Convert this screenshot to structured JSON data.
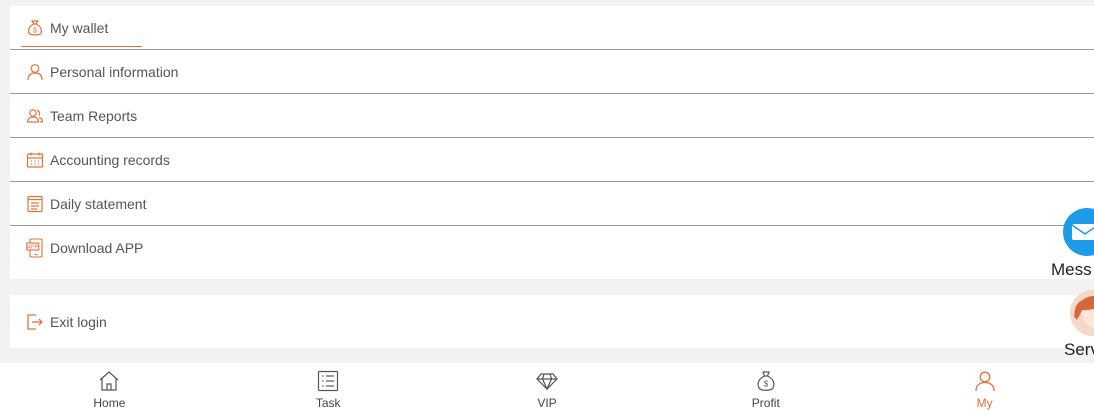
{
  "colors": {
    "accent": "#e0733a",
    "icon": "#e0733a",
    "text": "#555555",
    "message_bubble": "#1e9be8"
  },
  "menu": {
    "items": [
      {
        "label": "My wallet",
        "icon": "money-bag-icon",
        "active": true
      },
      {
        "label": "Personal information",
        "icon": "person-icon",
        "active": false
      },
      {
        "label": "Team Reports",
        "icon": "team-icon",
        "active": false
      },
      {
        "label": "Accounting records",
        "icon": "calendar-icon",
        "active": false
      },
      {
        "label": "Daily statement",
        "icon": "document-icon",
        "active": false
      },
      {
        "label": "Download APP",
        "icon": "app-icon",
        "active": false
      }
    ]
  },
  "exit": {
    "label": "Exit login",
    "icon": "exit-icon"
  },
  "floating": {
    "message_label": "Mess",
    "service_label": "Serv"
  },
  "tabbar": {
    "tabs": [
      {
        "label": "Home",
        "icon": "home-icon",
        "active": false
      },
      {
        "label": "Task",
        "icon": "task-list-icon",
        "active": false
      },
      {
        "label": "VIP",
        "icon": "diamond-icon",
        "active": false
      },
      {
        "label": "Profit",
        "icon": "money-bag-icon",
        "active": false
      },
      {
        "label": "My",
        "icon": "person-icon",
        "active": true
      }
    ]
  }
}
